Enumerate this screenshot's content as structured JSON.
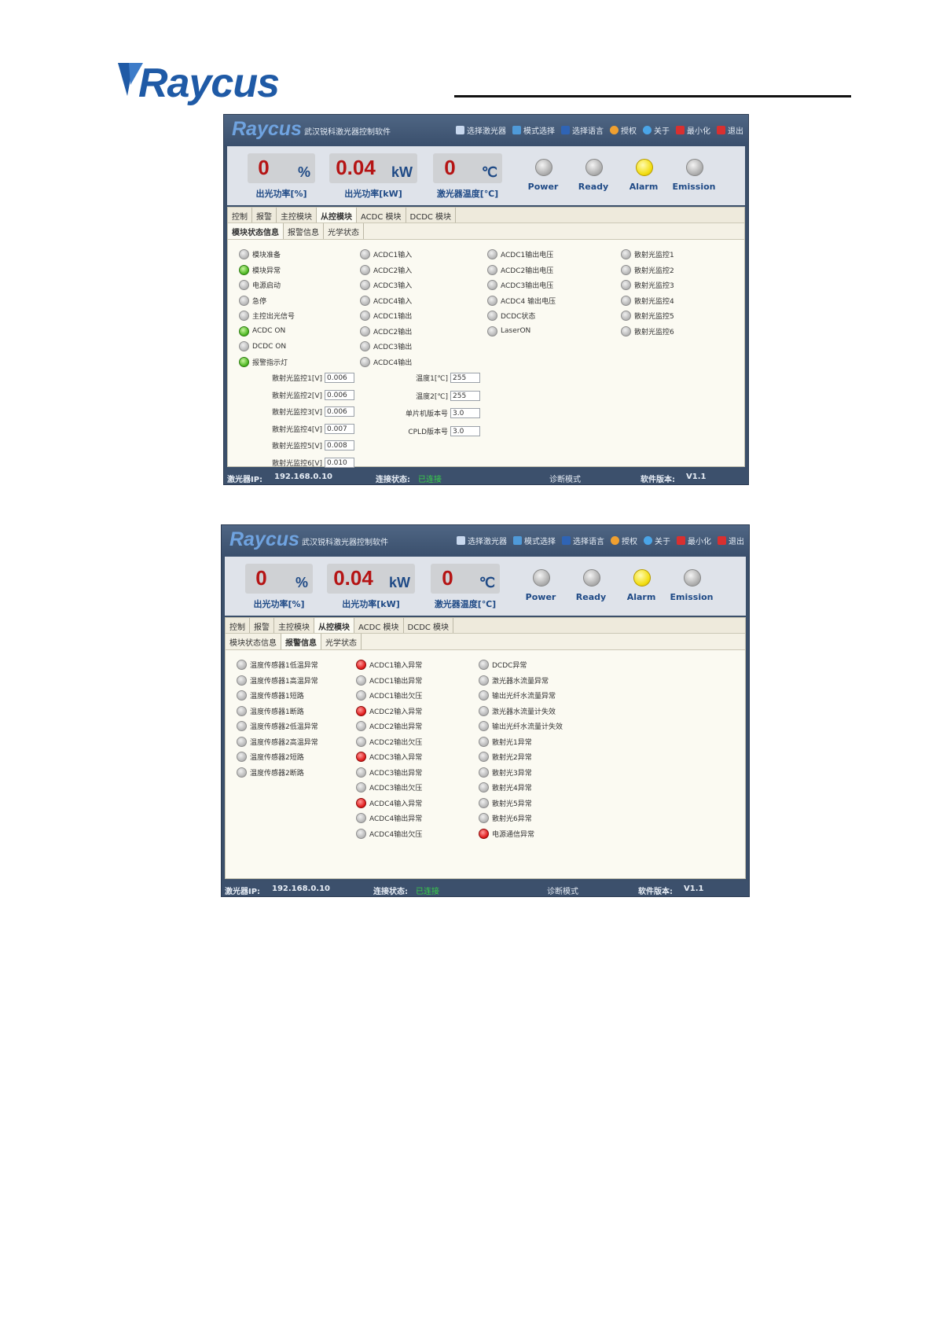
{
  "page": {
    "logo_text": "Raycus"
  },
  "windows": [
    {
      "titlebar": {
        "logo": "Raycus",
        "title": "武汉锐科激光器控制软件",
        "menu": [
          {
            "icon": "laser-select-icon",
            "label": "选择激光器",
            "color": "#c8d8ee"
          },
          {
            "icon": "mode-select-icon",
            "label": "模式选择",
            "color": "#4f9ad9"
          },
          {
            "icon": "language-icon",
            "label": "选择语言",
            "color": "#2f64b5"
          },
          {
            "icon": "authorize-icon",
            "label": "授权",
            "color": "#f0a030"
          },
          {
            "icon": "about-icon",
            "label": "关于",
            "color": "#4aa5e8"
          },
          {
            "icon": "minimize-icon",
            "label": "最小化",
            "color": "#d83030"
          },
          {
            "icon": "exit-icon",
            "label": "退出",
            "color": "#d83030"
          }
        ]
      },
      "gauges": [
        {
          "value": "0",
          "unit": "%",
          "caption": "出光功率[%]"
        },
        {
          "value": "0.04",
          "unit": "kW",
          "caption": "出光功率[kW]"
        },
        {
          "value": "0",
          "unit": "℃",
          "caption": "激光器温度[℃]"
        }
      ],
      "lamps": [
        {
          "label": "Power",
          "state": "grey"
        },
        {
          "label": "Ready",
          "state": "grey"
        },
        {
          "label": "Alarm",
          "state": "yellow"
        },
        {
          "label": "Emission",
          "state": "grey"
        }
      ],
      "tabs": [
        "控制",
        "报警",
        "主控模块",
        "从控模块",
        "ACDC 模块",
        "DCDC 模块"
      ],
      "active_tab": 3,
      "subtabs": [
        "模块状态信息",
        "报警信息",
        "光学状态"
      ],
      "active_subtab": 0,
      "indicator_columns": [
        [
          {
            "label": "模块准备",
            "state": "grey"
          },
          {
            "label": "模块异常",
            "state": "green"
          },
          {
            "label": "电源启动",
            "state": "grey"
          },
          {
            "label": "急停",
            "state": "grey"
          },
          {
            "label": "主控出光信号",
            "state": "grey"
          },
          {
            "label": "ACDC ON",
            "state": "green"
          },
          {
            "label": "DCDC ON",
            "state": "grey"
          },
          {
            "label": "报警指示灯",
            "state": "green"
          }
        ],
        [
          {
            "label": "ACDC1输入",
            "state": "grey"
          },
          {
            "label": "ACDC2输入",
            "state": "grey"
          },
          {
            "label": "ACDC3输入",
            "state": "grey"
          },
          {
            "label": "ACDC4输入",
            "state": "grey"
          },
          {
            "label": "ACDC1输出",
            "state": "grey"
          },
          {
            "label": "ACDC2输出",
            "state": "grey"
          },
          {
            "label": "ACDC3输出",
            "state": "grey"
          },
          {
            "label": "ACDC4输出",
            "state": "grey"
          }
        ],
        [
          {
            "label": "ACDC1输出电压",
            "state": "grey"
          },
          {
            "label": "ACDC2输出电压",
            "state": "grey"
          },
          {
            "label": "ACDC3输出电压",
            "state": "grey"
          },
          {
            "label": "ACDC4 输出电压",
            "state": "grey"
          },
          {
            "label": "DCDC状态",
            "state": "grey"
          },
          {
            "label": "LaserON",
            "state": "grey"
          }
        ],
        [
          {
            "label": "散射光监控1",
            "state": "grey"
          },
          {
            "label": "散射光监控2",
            "state": "grey"
          },
          {
            "label": "散射光监控3",
            "state": "grey"
          },
          {
            "label": "散射光监控4",
            "state": "grey"
          },
          {
            "label": "散射光监控5",
            "state": "grey"
          },
          {
            "label": "散射光监控6",
            "state": "grey"
          }
        ]
      ],
      "fields_left": [
        {
          "label": "散射光监控1[V]",
          "value": "0.006"
        },
        {
          "label": "散射光监控2[V]",
          "value": "0.006"
        },
        {
          "label": "散射光监控3[V]",
          "value": "0.006"
        },
        {
          "label": "散射光监控4[V]",
          "value": "0.007"
        },
        {
          "label": "散射光监控5[V]",
          "value": "0.008"
        },
        {
          "label": "散射光监控6[V]",
          "value": "0.010"
        }
      ],
      "fields_right": [
        {
          "label": "温度1[℃]",
          "value": "255"
        },
        {
          "label": "温度2[℃]",
          "value": "255"
        },
        {
          "label": "单片机版本号",
          "value": "3.0"
        },
        {
          "label": "CPLD版本号",
          "value": "3.0"
        }
      ],
      "status": {
        "ip_label": "激光器IP:",
        "ip": "192.168.0.10",
        "conn_label": "连接状态:",
        "conn": "已连接",
        "mode": "诊断模式",
        "ver_label": "软件版本:",
        "ver": "V1.1"
      }
    },
    {
      "titlebar": {
        "logo": "Raycus",
        "title": "武汉锐科激光器控制软件",
        "menu": [
          {
            "icon": "laser-select-icon",
            "label": "选择激光器",
            "color": "#c8d8ee"
          },
          {
            "icon": "mode-select-icon",
            "label": "模式选择",
            "color": "#4f9ad9"
          },
          {
            "icon": "language-icon",
            "label": "选择语言",
            "color": "#2f64b5"
          },
          {
            "icon": "authorize-icon",
            "label": "授权",
            "color": "#f0a030"
          },
          {
            "icon": "about-icon",
            "label": "关于",
            "color": "#4aa5e8"
          },
          {
            "icon": "minimize-icon",
            "label": "最小化",
            "color": "#d83030"
          },
          {
            "icon": "exit-icon",
            "label": "退出",
            "color": "#d83030"
          }
        ]
      },
      "gauges": [
        {
          "value": "0",
          "unit": "%",
          "caption": "出光功率[%]"
        },
        {
          "value": "0.04",
          "unit": "kW",
          "caption": "出光功率[kW]"
        },
        {
          "value": "0",
          "unit": "℃",
          "caption": "激光器温度[℃]"
        }
      ],
      "lamps": [
        {
          "label": "Power",
          "state": "grey"
        },
        {
          "label": "Ready",
          "state": "grey"
        },
        {
          "label": "Alarm",
          "state": "yellow"
        },
        {
          "label": "Emission",
          "state": "grey"
        }
      ],
      "tabs": [
        "控制",
        "报警",
        "主控模块",
        "从控模块",
        "ACDC 模块",
        "DCDC 模块"
      ],
      "active_tab": 3,
      "subtabs": [
        "模块状态信息",
        "报警信息",
        "光学状态"
      ],
      "active_subtab": 1,
      "indicator_columns": [
        [
          {
            "label": "温度传感器1低温异常",
            "state": "grey"
          },
          {
            "label": "温度传感器1高温异常",
            "state": "grey"
          },
          {
            "label": "温度传感器1短路",
            "state": "grey"
          },
          {
            "label": "温度传感器1断路",
            "state": "grey"
          },
          {
            "label": "温度传感器2低温异常",
            "state": "grey"
          },
          {
            "label": "温度传感器2高温异常",
            "state": "grey"
          },
          {
            "label": "温度传感器2短路",
            "state": "grey"
          },
          {
            "label": "温度传感器2断路",
            "state": "grey"
          }
        ],
        [
          {
            "label": "ACDC1输入异常",
            "state": "red"
          },
          {
            "label": "ACDC1输出异常",
            "state": "grey"
          },
          {
            "label": "ACDC1输出欠压",
            "state": "grey"
          },
          {
            "label": "ACDC2输入异常",
            "state": "red"
          },
          {
            "label": "ACDC2输出异常",
            "state": "grey"
          },
          {
            "label": "ACDC2输出欠压",
            "state": "grey"
          },
          {
            "label": "ACDC3输入异常",
            "state": "red"
          },
          {
            "label": "ACDC3输出异常",
            "state": "grey"
          },
          {
            "label": "ACDC3输出欠压",
            "state": "grey"
          },
          {
            "label": "ACDC4输入异常",
            "state": "red"
          },
          {
            "label": "ACDC4输出异常",
            "state": "grey"
          },
          {
            "label": "ACDC4输出欠压",
            "state": "grey"
          }
        ],
        [
          {
            "label": "DCDC异常",
            "state": "grey"
          },
          {
            "label": "激光器水流量异常",
            "state": "grey"
          },
          {
            "label": "输出光纤水流量异常",
            "state": "grey"
          },
          {
            "label": "激光器水流量计失效",
            "state": "grey"
          },
          {
            "label": "输出光纤水流量计失效",
            "state": "grey"
          },
          {
            "label": "散射光1异常",
            "state": "grey"
          },
          {
            "label": "散射光2异常",
            "state": "grey"
          },
          {
            "label": "散射光3异常",
            "state": "grey"
          },
          {
            "label": "散射光4异常",
            "state": "grey"
          },
          {
            "label": "散射光5异常",
            "state": "grey"
          },
          {
            "label": "散射光6异常",
            "state": "grey"
          },
          {
            "label": "电源通信异常",
            "state": "red"
          }
        ]
      ],
      "fields_left": [],
      "fields_right": [],
      "status": {
        "ip_label": "激光器IP:",
        "ip": "192.168.0.10",
        "conn_label": "连接状态:",
        "conn": "已连接",
        "mode": "诊断模式",
        "ver_label": "软件版本:",
        "ver": "V1.1"
      }
    }
  ]
}
